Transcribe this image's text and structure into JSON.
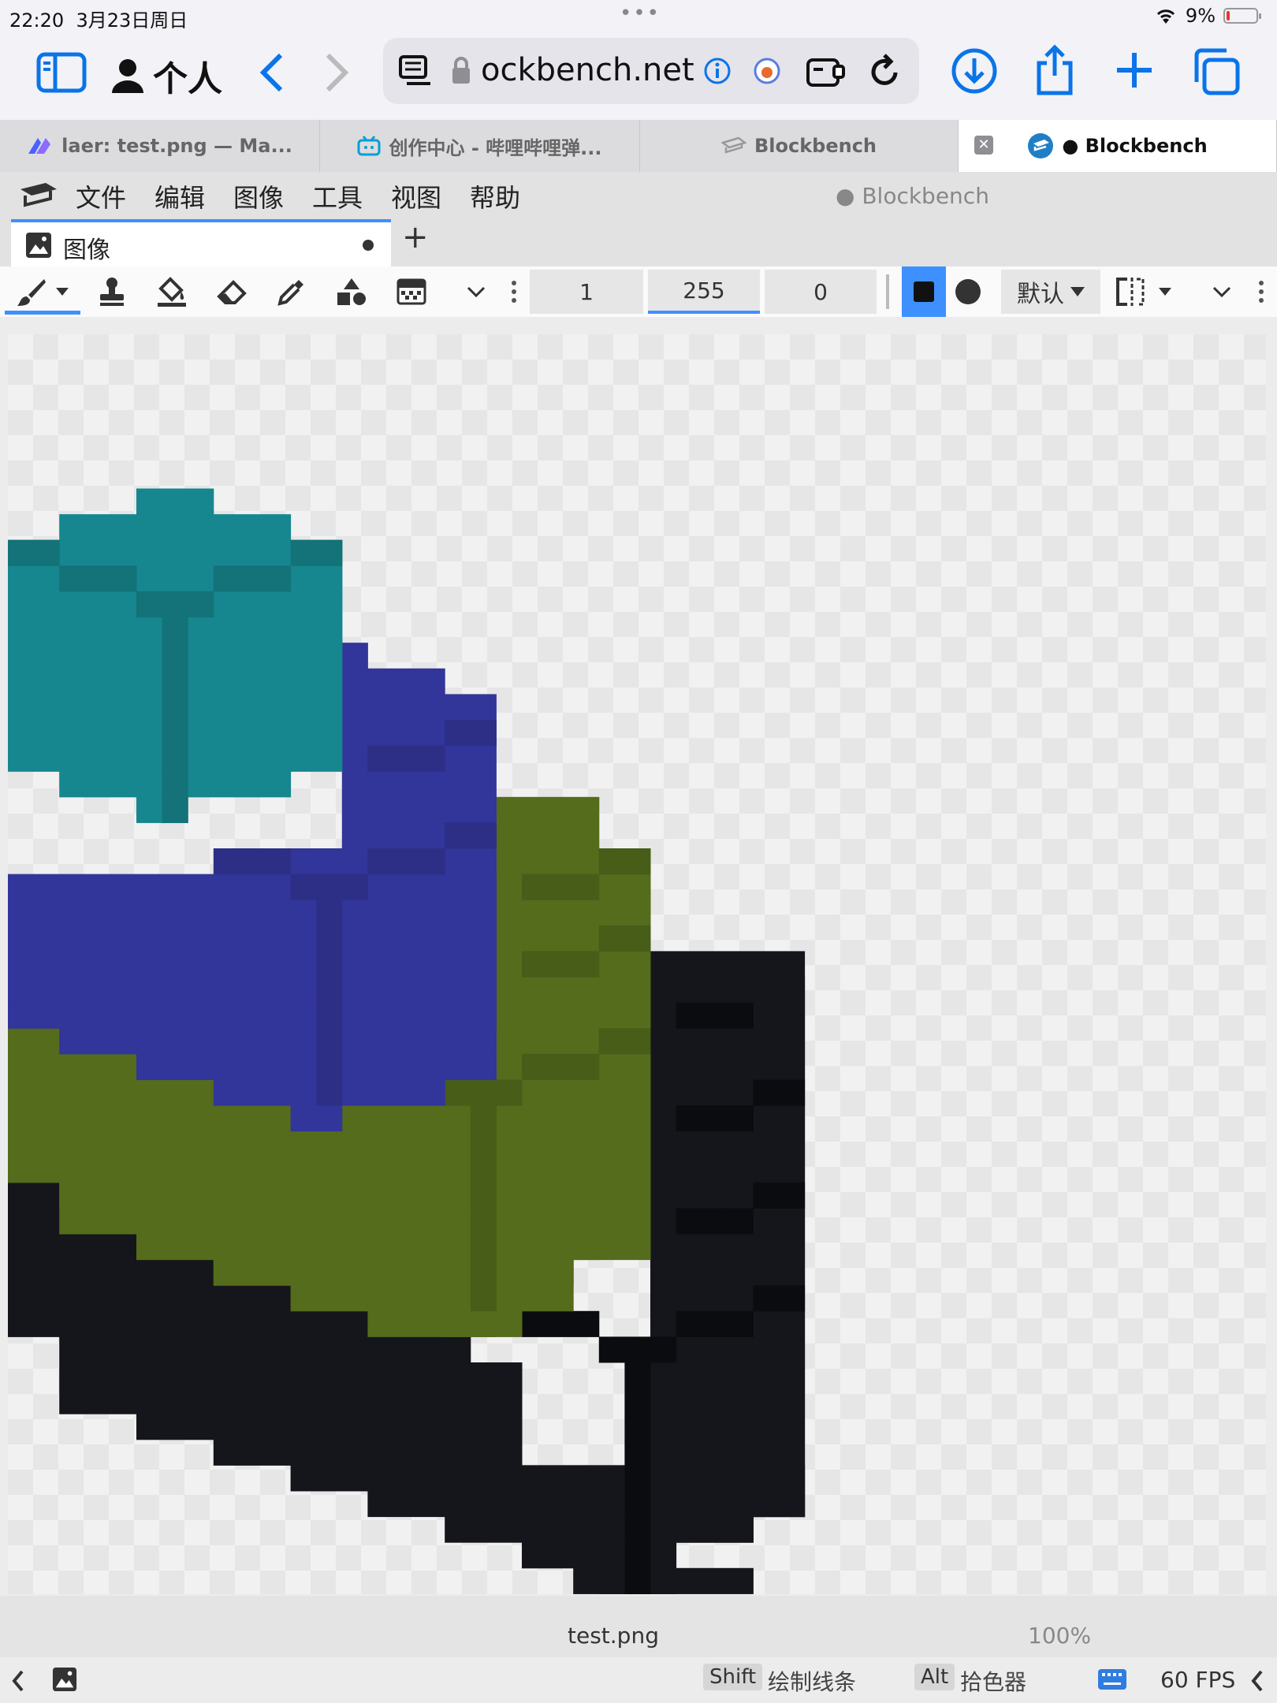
{
  "status": {
    "time": "22:20",
    "date": "3月23日周日",
    "battery": "9%"
  },
  "browser": {
    "profile_label": "个人",
    "url": "ockbench.net",
    "tabs": [
      {
        "label": "laer: test.png — Ma..."
      },
      {
        "label": "创作中心 - 哔哩哔哩弹..."
      },
      {
        "label": "Blockbench"
      },
      {
        "label": "● Blockbench"
      }
    ]
  },
  "app": {
    "title": "● Blockbench",
    "menu": [
      "文件",
      "编辑",
      "图像",
      "工具",
      "视图",
      "帮助"
    ],
    "doc_tab": "图像",
    "fields": {
      "size": "1",
      "opacity": "255",
      "softness": "0"
    },
    "blend_mode": "默认",
    "filename": "test.png",
    "zoom": "100%",
    "hints": {
      "key1": "Shift",
      "hint1": "绘制线条",
      "key2": "Alt",
      "hint2": "拾色器"
    },
    "fps": "60 FPS"
  },
  "colors": {
    "teal": "#16868f",
    "teal_dark": "#147279",
    "blue": "#32359a",
    "blue_dark": "#2d2f87",
    "green": "#546c1b",
    "green_dark": "#475d18",
    "black": "#15161b",
    "black_dark": "#0b0c0f",
    "accent": "#0a74e8"
  }
}
